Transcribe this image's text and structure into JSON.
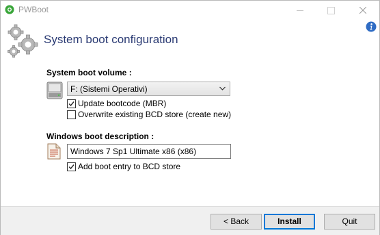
{
  "window": {
    "title": "PWBoot"
  },
  "header": {
    "title": "System boot configuration"
  },
  "boot_volume": {
    "label": "System boot volume :",
    "selected": "F: (Sistemi Operativi)",
    "options": [
      {
        "label": "Update bootcode (MBR)",
        "checked": true
      },
      {
        "label": "Overwrite existing BCD store (create new)",
        "checked": false
      }
    ]
  },
  "boot_description": {
    "label": "Windows boot description :",
    "value": "Windows 7 Sp1 Ultimate x86 (x86)",
    "options": [
      {
        "label": "Add boot entry to BCD store",
        "checked": true
      }
    ]
  },
  "buttons": {
    "back": "< Back",
    "install": "Install",
    "quit": "Quit"
  },
  "icons": {
    "app": "pwboot-app-icon",
    "header": "gears-icon",
    "info": "info-icon",
    "drive": "hard-drive-icon",
    "document": "document-icon"
  }
}
